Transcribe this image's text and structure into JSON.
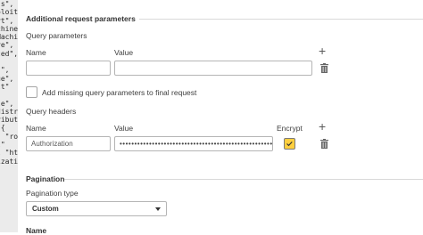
{
  "background_code": {
    "lines": [
      "\"s\",",
      "oloit",
      "rt\",",
      "chine",
      "Machi",
      "re\",",
      "zed\",",
      "",
      "s\",",
      "ue\",",
      "lt\"",
      "",
      "le\",",
      "distr",
      "ribut",
      "\"{",
      ") \"ro",
      "l\"",
      "l \"ht",
      "izati",
      ""
    ]
  },
  "additional_request_parameters": {
    "title": "Additional request parameters",
    "query_parameters": {
      "label": "Query parameters",
      "name_col": "Name",
      "value_col": "Value",
      "row": {
        "name": "",
        "value": ""
      }
    },
    "add_missing_label": "Add missing query parameters to final request",
    "query_headers": {
      "label": "Query headers",
      "name_col": "Name",
      "value_col": "Value",
      "encrypt_col": "Encrypt",
      "row": {
        "name": "Authorization",
        "value": "••••••••••••••••••••••••••••••••••••••••••••••••••••",
        "encrypt": true
      }
    }
  },
  "pagination": {
    "title": "Pagination",
    "type_label": "Pagination type",
    "type_value": "Custom",
    "next_label": "Name"
  },
  "colors": {
    "checkbox_checked": "#ffcf3f",
    "divider": "#d9d9d9",
    "text": "#404040"
  },
  "icons": [
    "plus-icon",
    "trash-icon",
    "checkmark-icon",
    "caret-down-icon"
  ]
}
